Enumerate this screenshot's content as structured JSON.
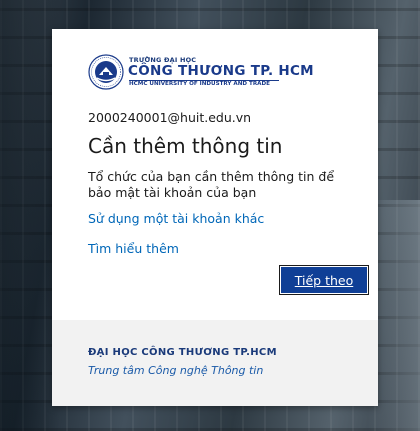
{
  "colors": {
    "link": "#0067b8",
    "button_bg": "#0f3f96",
    "brand_navy": "#1a3a8a",
    "footer_bg": "#f2f2f2"
  },
  "logo": {
    "icon": "university-emblem-icon",
    "top_text": "TRƯỜNG ĐẠI HỌC",
    "main_text": "CÔNG THƯƠNG TP. HCM",
    "sub_text": "HCMC UNIVERSITY OF INDUSTRY AND TRADE"
  },
  "account": {
    "email": "2000240001@huit.edu.vn"
  },
  "main": {
    "title": "Cần thêm thông tin",
    "description": "Tổ chức của bạn cần thêm thông tin để bảo mật tài khoản của bạn",
    "use_other_account_link": "Sử dụng một tài khoản khác",
    "learn_more_link": "Tìm hiểu thêm",
    "next_button": "Tiếp theo"
  },
  "footer": {
    "title": "ĐẠI HỌC CÔNG THƯƠNG TP.HCM",
    "subtitle": "Trung tâm Công nghệ Thông tin"
  }
}
